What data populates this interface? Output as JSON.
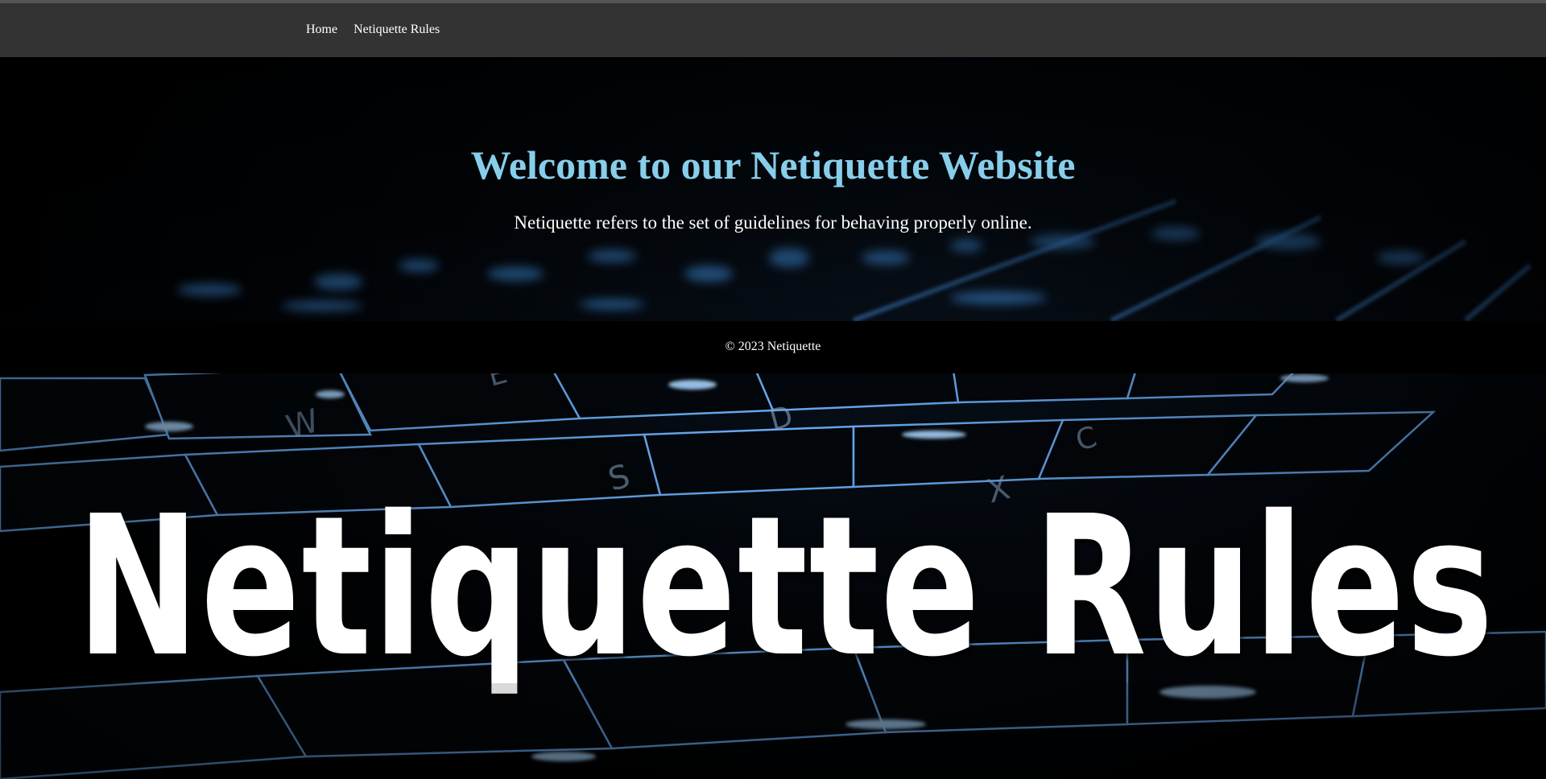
{
  "nav": {
    "items": [
      {
        "label": "Home"
      },
      {
        "label": "Netiquette Rules"
      }
    ]
  },
  "hero": {
    "title": "Welcome to our Netiquette Website",
    "subtitle": "Netiquette refers to the set of guidelines for behaving properly online."
  },
  "footer": {
    "copyright": "© 2023 Netiquette"
  },
  "banner": {
    "title": "Netiquette Rules"
  },
  "colors": {
    "nav_bg": "#333333",
    "hero_title": "#87ceeb",
    "text": "#ffffff",
    "key_glow": "#5aa9ff"
  }
}
